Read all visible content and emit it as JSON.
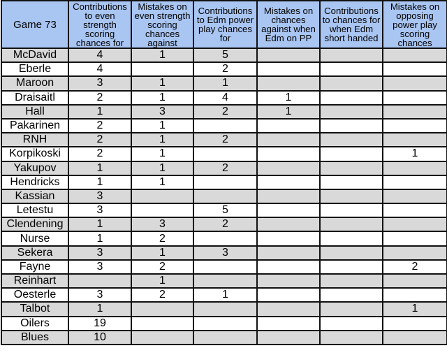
{
  "table": {
    "header": [
      "Game 73",
      "Contributions to even strength scoring chances for",
      "Mistakes on even strength scoring chances against",
      "Contributions to Edm power play chances for",
      "Mistakes on chances against when Edm on PP",
      "Contributions to chances for when Edm short handed",
      "Mistakes on opposing power play scoring chances"
    ],
    "rows": [
      [
        "McDavid",
        "4",
        "1",
        "5",
        "",
        "",
        ""
      ],
      [
        "Eberle",
        "4",
        "",
        "2",
        "",
        "",
        ""
      ],
      [
        "Maroon",
        "3",
        "1",
        "1",
        "",
        "",
        ""
      ],
      [
        "Draisaitl",
        "2",
        "1",
        "4",
        "1",
        "",
        ""
      ],
      [
        "Hall",
        "1",
        "3",
        "2",
        "1",
        "",
        ""
      ],
      [
        "Pakarinen",
        "2",
        "1",
        "",
        "",
        "",
        ""
      ],
      [
        "RNH",
        "2",
        "1",
        "2",
        "",
        "",
        ""
      ],
      [
        "Korpikoski",
        "2",
        "1",
        "",
        "",
        "",
        "1"
      ],
      [
        "Yakupov",
        "1",
        "1",
        "2",
        "",
        "",
        ""
      ],
      [
        "Hendricks",
        "1",
        "1",
        "",
        "",
        "",
        ""
      ],
      [
        "Kassian",
        "3",
        "",
        "",
        "",
        "",
        ""
      ],
      [
        "Letestu",
        "3",
        "",
        "5",
        "",
        "",
        ""
      ],
      [
        "Clendening",
        "1",
        "3",
        "2",
        "",
        "",
        ""
      ],
      [
        "Nurse",
        "1",
        "2",
        "",
        "",
        "",
        ""
      ],
      [
        "Sekera",
        "3",
        "1",
        "3",
        "",
        "",
        ""
      ],
      [
        "Fayne",
        "3",
        "2",
        "",
        "",
        "",
        "2"
      ],
      [
        "Reinhart",
        "",
        "1",
        "",
        "",
        "",
        ""
      ],
      [
        "Oesterle",
        "3",
        "2",
        "1",
        "",
        "",
        ""
      ],
      [
        "Talbot",
        "1",
        "",
        "",
        "",
        "",
        "1"
      ],
      [
        "Oilers",
        "19",
        "",
        "",
        "",
        "",
        ""
      ],
      [
        "Blues",
        "10",
        "",
        "",
        "",
        "",
        ""
      ]
    ]
  },
  "colors": {
    "header_bg": "#a9c5f2",
    "shaded_row_bg": "#d9d9d9",
    "plain_row_bg": "#ffffff",
    "border": "#111111"
  }
}
